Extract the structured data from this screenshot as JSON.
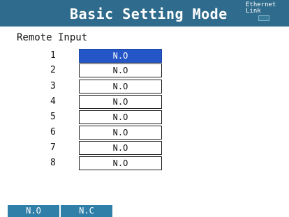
{
  "header": {
    "title": "Basic Setting Mode",
    "ethernet_label": "Ethernet",
    "link_label": "Link"
  },
  "section": {
    "label": "Remote Input"
  },
  "rows": [
    {
      "num": "1",
      "value": "N.O",
      "selected": true
    },
    {
      "num": "2",
      "value": "N.O",
      "selected": false
    },
    {
      "num": "3",
      "value": "N.O",
      "selected": false
    },
    {
      "num": "4",
      "value": "N.O",
      "selected": false
    },
    {
      "num": "5",
      "value": "N.O",
      "selected": false
    },
    {
      "num": "6",
      "value": "N.O",
      "selected": false
    },
    {
      "num": "7",
      "value": "N.O",
      "selected": false
    },
    {
      "num": "8",
      "value": "N.O",
      "selected": false
    }
  ],
  "softkeys": [
    {
      "label": "N.O"
    },
    {
      "label": "N.C"
    }
  ],
  "colors": {
    "header_bg": "#2f6b8c",
    "selected_bg": "#2456c8",
    "softkey_bg": "#2f7fa8"
  }
}
